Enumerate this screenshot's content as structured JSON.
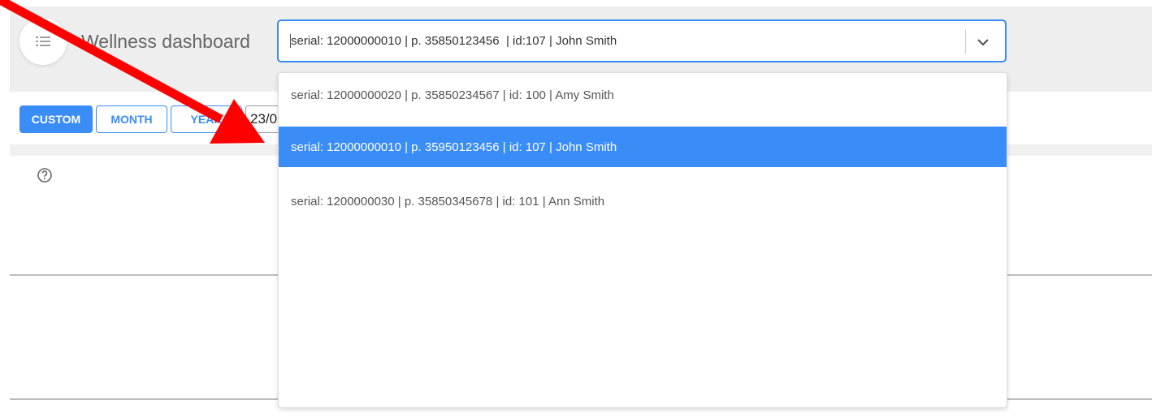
{
  "header": {
    "title": "Wellness dashboard"
  },
  "device_select": {
    "value": "serial: 12000000010 | p. 35850123456  | id:107 | John Smith",
    "options": [
      "serial: 12000000020 | p. 35850234567 | id: 100 | Amy Smith",
      "serial: 12000000010 | p. 35950123456 | id: 107 | John Smith",
      "serial: 1200000030 | p. 35850345678 | id: 101 | Ann Smith"
    ],
    "highlighted_index": 1
  },
  "period_buttons": {
    "custom": "CUSTOM",
    "month": "MONTH",
    "year": "YEAR",
    "active": "custom"
  },
  "date_input": {
    "value": "23/0"
  },
  "icons": {
    "menu": "list-icon",
    "select_arrow": "chevron-down-icon",
    "help": "help-circle-icon",
    "annotation": "red-arrow"
  },
  "colors": {
    "accent": "#3a8cf7",
    "annotation": "#ff0000",
    "header_bg": "#eeeeee"
  }
}
